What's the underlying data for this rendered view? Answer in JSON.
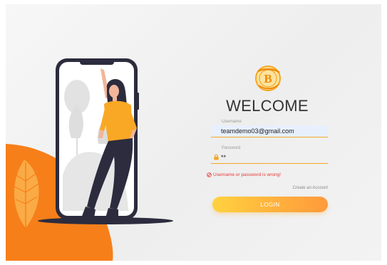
{
  "welcome_title": "WELCOME",
  "username": {
    "label": "Username",
    "value": "teamdemo03@gmail.com"
  },
  "password": {
    "label": "Password",
    "value": "**"
  },
  "error_message": "Username or password is wrong!",
  "create_account_link": "Create an Account",
  "login_button": "LOGIN",
  "icons": {
    "logo": "coin-b-logo-icon",
    "user": "user-icon",
    "lock": "lock-icon",
    "error": "error-circle-icon"
  },
  "colors": {
    "accent": "#f5a623",
    "login_gradient_start": "#ffd23f",
    "login_gradient_end": "#ff9a3c",
    "error": "#e53935",
    "orange_shape": "#f77f1a",
    "autofill_bg": "#e8f0fe"
  }
}
